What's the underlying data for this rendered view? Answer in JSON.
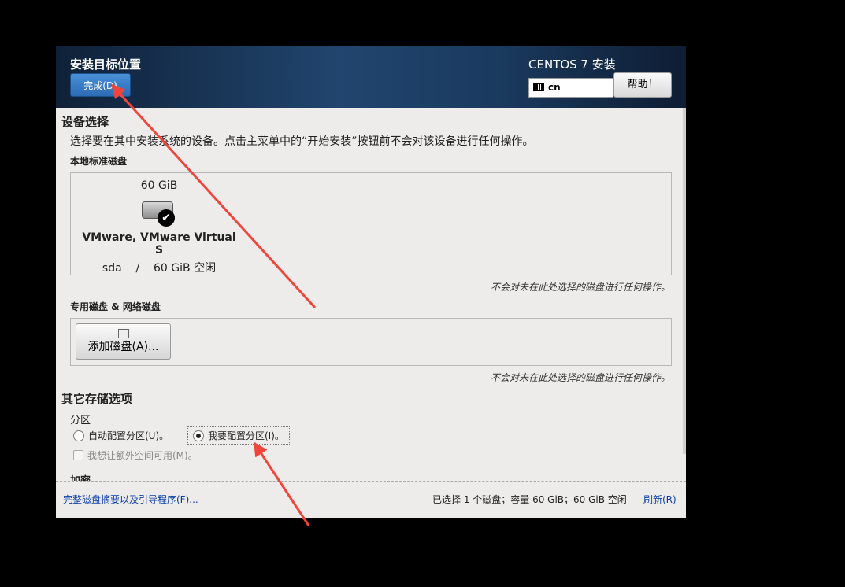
{
  "header": {
    "title": "安装目标位置",
    "done_label": "完成(D)",
    "product": "CENTOS 7 安装",
    "keyboard": "cn",
    "help_label": "帮助！"
  },
  "device_selection": {
    "heading": "设备选择",
    "description": "选择要在其中安装系统的设备。点击主菜单中的“开始安装”按钮前不会对该设备进行任何操作。",
    "local_label": "本地标准磁盘",
    "disk": {
      "size": "60 GiB",
      "name": "VMware, VMware Virtual S",
      "device": "sda",
      "separator": "/",
      "free": "60 GiB 空闲"
    },
    "local_note": "不会对未在此处选择的磁盘进行任何操作。",
    "special_label": "专用磁盘 & 网络磁盘",
    "add_disk_label": "添加磁盘(A)...",
    "special_note": "不会对未在此处选择的磁盘进行任何操作。"
  },
  "other_storage": {
    "heading": "其它存储选项",
    "partition_label": "分区",
    "auto_label": "自动配置分区(U)。",
    "manual_label": "我要配置分区(I)。",
    "extra_space_label": "我想让额外空间可用(M)。",
    "encrypt_label": "加密"
  },
  "footer": {
    "summary_link": "完整磁盘摘要以及引导程序(F)...",
    "status": "已选择 1 个磁盘；容量 60 GiB；60 GiB 空闲",
    "refresh_link": "刷新(R)"
  },
  "colors": {
    "header_dark": "#0f2138",
    "header_mid": "#21456e",
    "done_button": "#2c6cb5",
    "annotation_arrow": "#f0453a"
  }
}
